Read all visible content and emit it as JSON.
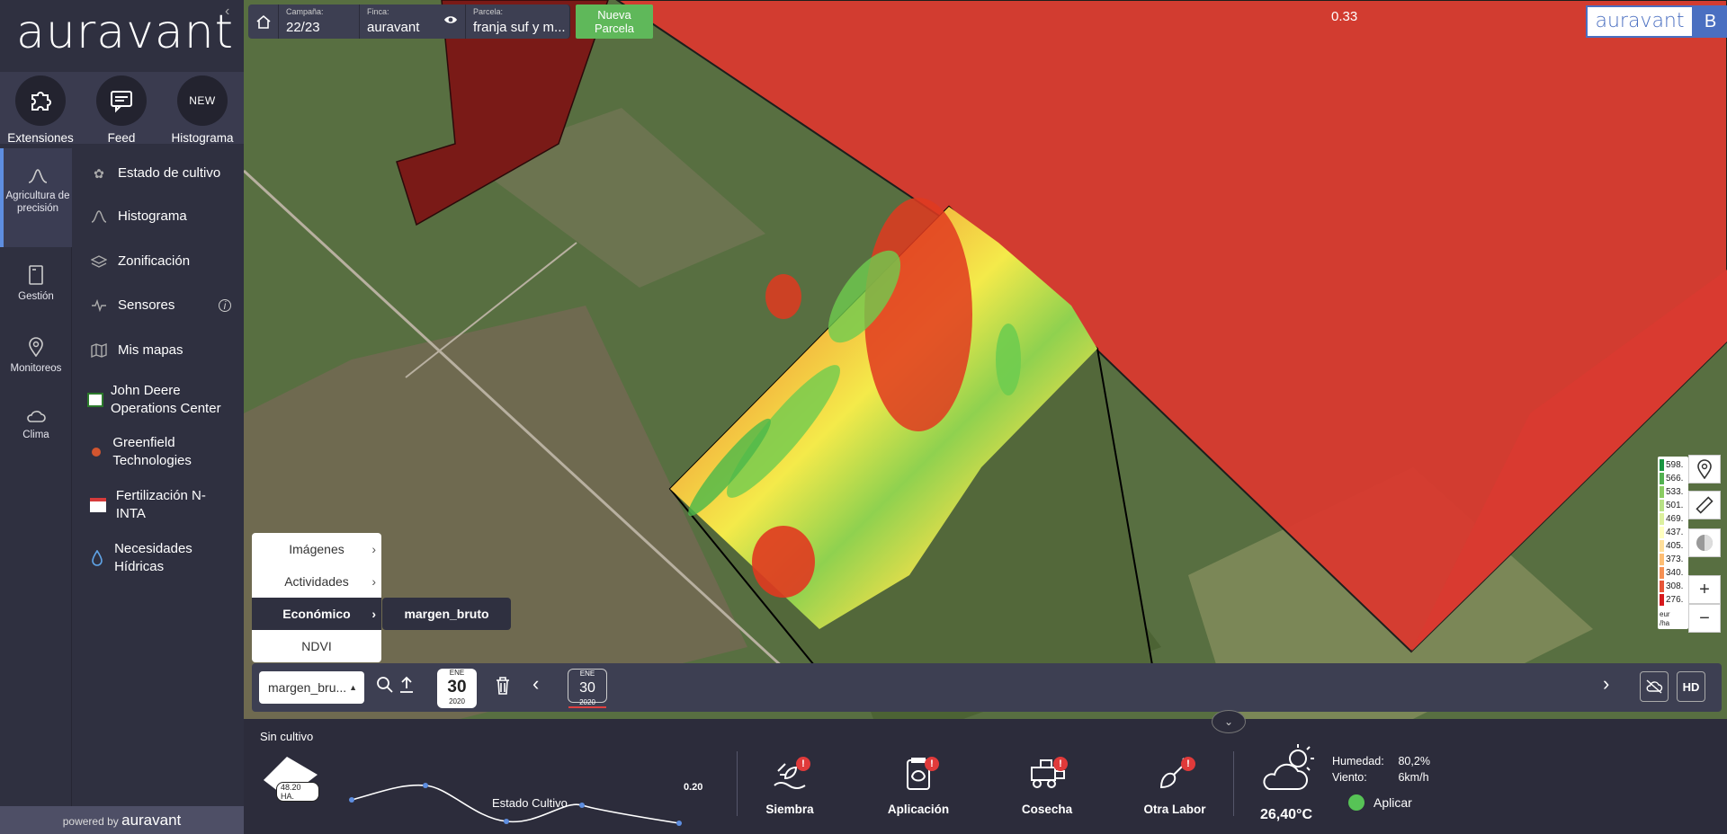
{
  "sidebar": {
    "brand": "auravant",
    "tools": [
      {
        "label": "Extensiones",
        "icon": "puzzle-icon"
      },
      {
        "label": "Feed",
        "icon": "chat-icon"
      },
      {
        "label": "Histograma",
        "badge": "NEW"
      }
    ],
    "categories": [
      {
        "label": "Agricultura de precisión",
        "icon": "curve-icon",
        "active": true
      },
      {
        "label": "Gestión",
        "icon": "notebook-icon"
      },
      {
        "label": "Monitoreos",
        "icon": "pin-icon"
      },
      {
        "label": "Clima",
        "icon": "cloud-icon"
      }
    ],
    "menu": [
      {
        "label": "Estado de cultivo",
        "icon": "plant-icon"
      },
      {
        "label": "Histograma",
        "icon": "histogram-icon"
      },
      {
        "label": "Zonificación",
        "icon": "layers-icon"
      },
      {
        "label": "Sensores",
        "icon": "pulse-icon",
        "info": "i"
      },
      {
        "label": "Mis mapas",
        "icon": "map-icon"
      },
      {
        "label": "John Deere Operations Center",
        "icon": "john-deere-icon"
      },
      {
        "label": "Greenfield Technologies",
        "icon": "greenfield-icon"
      },
      {
        "label": "Fertilización N-INTA",
        "icon": "inta-icon"
      },
      {
        "label": "Necesidades Hídricas",
        "icon": "drop-icon"
      }
    ],
    "powered_prefix": "powered by",
    "powered_brand": "auravant"
  },
  "topbar": {
    "campaign_label": "Campaña:",
    "campaign_value": "22/23",
    "farm_label": "Finca:",
    "farm_value": "auravant",
    "plot_label": "Parcela:",
    "plot_value": "franja suf y m...",
    "new_plot_line1": "Nueva",
    "new_plot_line2": "Parcela"
  },
  "map": {
    "ndvi_value": "0.33",
    "brand": "auravant",
    "user_initial": "B",
    "legend": {
      "entries": [
        {
          "label": "598.",
          "color": "#1a9641"
        },
        {
          "label": "566.",
          "color": "#52b151"
        },
        {
          "label": "533.",
          "color": "#8acc62"
        },
        {
          "label": "501.",
          "color": "#b8e186"
        },
        {
          "label": "469.",
          "color": "#dcf09e"
        },
        {
          "label": "437.",
          "color": "#ffffc0"
        },
        {
          "label": "405.",
          "color": "#ffdf9a"
        },
        {
          "label": "373.",
          "color": "#febe74"
        },
        {
          "label": "340.",
          "color": "#f69053"
        },
        {
          "label": "308.",
          "color": "#e75437"
        },
        {
          "label": "276.",
          "color": "#d7191c"
        }
      ],
      "unit_line1": "eur",
      "unit_line2": "/ha"
    },
    "controls": {
      "zoom_in": "+",
      "zoom_out": "−",
      "quality": "HD"
    }
  },
  "layer_menu": {
    "items": [
      {
        "label": "Imágenes",
        "has_sub": true
      },
      {
        "label": "Actividades",
        "has_sub": true
      },
      {
        "label": "Económico",
        "has_sub": true,
        "selected": true
      },
      {
        "label": "NDVI",
        "has_sub": false
      }
    ],
    "submenu_item": "margen_bruto"
  },
  "timeline": {
    "selected_layer": "margen_bru...",
    "date_selected": {
      "month": "ENE",
      "day": "30",
      "year": "2020"
    },
    "date_marker": {
      "month": "ENE",
      "day": "30",
      "year": "2020"
    }
  },
  "bottom": {
    "crop_status": "Sin cultivo",
    "area": "48.20 HA.",
    "curve_label": "Estado Cultivo",
    "curve_value": "0.20",
    "actions": [
      {
        "label": "Siembra",
        "icon": "seeding-icon",
        "alert": "!"
      },
      {
        "label": "Aplicación",
        "icon": "sprayer-icon",
        "alert": "!"
      },
      {
        "label": "Cosecha",
        "icon": "harvester-icon",
        "alert": "!"
      },
      {
        "label": "Otra Labor",
        "icon": "shovel-icon",
        "alert": "!"
      }
    ],
    "weather": {
      "temperature": "26,40°C",
      "humidity_label": "Humedad:",
      "humidity_value": "80,2%",
      "wind_label": "Viento:",
      "wind_value": "6km/h",
      "apply_label": "Aplicar"
    }
  }
}
